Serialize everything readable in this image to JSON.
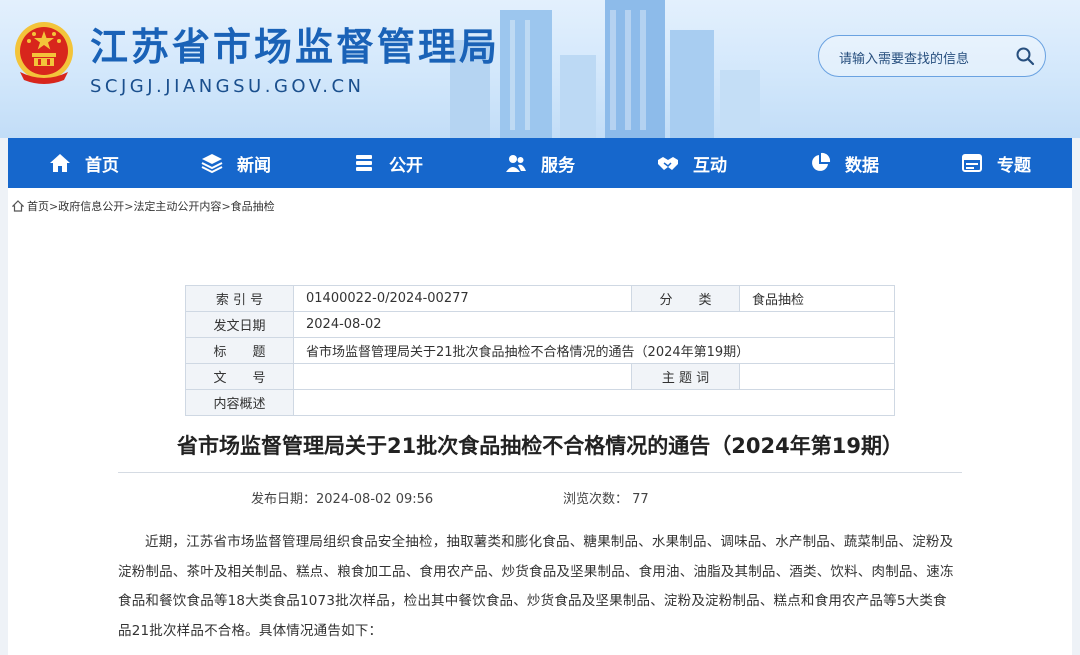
{
  "header": {
    "site_title": "江苏省市场监督管理局",
    "site_domain": "SCJGJ.JIANGSU.GOV.CN",
    "search_placeholder": "请输入需要查找的信息"
  },
  "nav": [
    {
      "label": "首页",
      "icon": "home-icon"
    },
    {
      "label": "新闻",
      "icon": "layers-icon"
    },
    {
      "label": "公开",
      "icon": "stack-icon"
    },
    {
      "label": "服务",
      "icon": "people-icon"
    },
    {
      "label": "互动",
      "icon": "handshake-icon"
    },
    {
      "label": "数据",
      "icon": "pie-chart-icon"
    },
    {
      "label": "专题",
      "icon": "window-icon"
    }
  ],
  "breadcrumb": {
    "home": "首页",
    "sep": ">",
    "level1": "政府信息公开",
    "level2": "法定主动公开内容",
    "level3": "食品抽检"
  },
  "meta": {
    "index_label": "索 引 号",
    "index_value": "01400022-0/2024-00277",
    "category_label": "分　　类",
    "category_value": "食品抽检",
    "date_label": "发文日期",
    "date_value": "2024-08-02",
    "title_label": "标　　题",
    "title_value": "省市场监督管理局关于21批次食品抽检不合格情况的通告（2024年第19期）",
    "docno_label": "文　　号",
    "docno_value": "",
    "subject_label": "主 题 词",
    "subject_value": "",
    "summary_label": "内容概述",
    "summary_value": ""
  },
  "article": {
    "title": "省市场监督管理局关于21批次食品抽检不合格情况的通告（2024年第19期）",
    "publish_label": "发布日期：",
    "publish_value": "2024-08-02 09:56",
    "views_label": "浏览次数：",
    "views_value": "77",
    "body": "近期，江苏省市场监督管理局组织食品安全抽检，抽取薯类和膨化食品、糖果制品、水果制品、调味品、水产制品、蔬菜制品、淀粉及淀粉制品、茶叶及相关制品、糕点、粮食加工品、食用农产品、炒货食品及坚果制品、食用油、油脂及其制品、酒类、饮料、肉制品、速冻食品和餐饮食品等18大类食品1073批次样品，检出其中餐饮食品、炒货食品及坚果制品、淀粉及淀粉制品、糕点和食用农产品等5大类食品21批次样品不合格。具体情况通告如下："
  },
  "colors": {
    "brand_blue": "#1667cc",
    "title_blue": "#1a62b7",
    "emblem_red": "#d8261c",
    "emblem_gold": "#f3c43a"
  }
}
